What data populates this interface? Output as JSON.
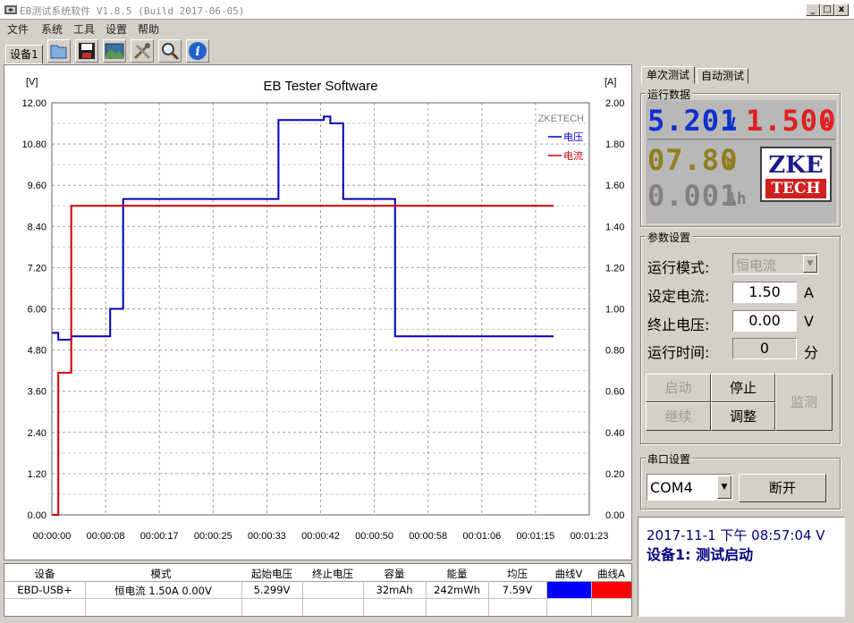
{
  "window": {
    "title": "EB测试系统软件 V1.8.5 (Build 2017-06-05)",
    "minimize": "_",
    "maximize": "□",
    "close": "x"
  },
  "menu": [
    "文件",
    "系统",
    "工具",
    "设置",
    "帮助"
  ],
  "device_tab": "设备1",
  "toolbar_icons": [
    "open-icon",
    "save-icon",
    "image-icon",
    "tools-icon",
    "search-icon",
    "info-icon"
  ],
  "chart_data": {
    "type": "line",
    "title": "EB Tester Software",
    "left_unit": "[V]",
    "right_unit": "[A]",
    "watermark": "ZKETECH",
    "left_ticks": [
      "12.00",
      "10.80",
      "9.60",
      "8.40",
      "7.20",
      "6.00",
      "4.80",
      "3.60",
      "2.40",
      "1.20",
      "0.00"
    ],
    "right_ticks": [
      "2.00",
      "1.80",
      "1.60",
      "1.40",
      "1.20",
      "1.00",
      "0.80",
      "0.60",
      "0.40",
      "0.20",
      "0.00"
    ],
    "x_ticks": [
      "00:00:00",
      "00:00:08",
      "00:00:17",
      "00:00:25",
      "00:00:33",
      "00:00:42",
      "00:00:50",
      "00:00:58",
      "00:01:06",
      "00:01:15",
      "00:01:23"
    ],
    "ylim_left": [
      0,
      12
    ],
    "ylim_right": [
      0,
      2
    ],
    "xlim": [
      0,
      83
    ],
    "legend_position": "top-right",
    "series": [
      {
        "name": "电压",
        "axis": "left",
        "color": "#0000c0",
        "points": [
          [
            0,
            5.3
          ],
          [
            1,
            5.3
          ],
          [
            1,
            5.1
          ],
          [
            3,
            5.1
          ],
          [
            3,
            5.2
          ],
          [
            9,
            5.2
          ],
          [
            9,
            6.0
          ],
          [
            11,
            6.0
          ],
          [
            11,
            9.2
          ],
          [
            35,
            9.2
          ],
          [
            35,
            11.5
          ],
          [
            42,
            11.5
          ],
          [
            42,
            11.6
          ],
          [
            43,
            11.6
          ],
          [
            43,
            11.4
          ],
          [
            45,
            11.4
          ],
          [
            45,
            9.2
          ],
          [
            53,
            9.2
          ],
          [
            53,
            5.2
          ],
          [
            77.5,
            5.2
          ]
        ]
      },
      {
        "name": "电流",
        "axis": "right",
        "color": "#d00000",
        "points": [
          [
            0,
            0.0
          ],
          [
            1,
            0.0
          ],
          [
            1,
            0.69
          ],
          [
            3,
            0.69
          ],
          [
            3,
            1.5
          ],
          [
            77.5,
            1.5
          ]
        ]
      }
    ]
  },
  "table": {
    "headers": [
      "设备",
      "模式",
      "起始电压",
      "终止电压",
      "容量",
      "能量",
      "均压",
      "曲线V",
      "曲线A"
    ],
    "row": {
      "device": "EBD-USB+",
      "mode": "恒电流  1.50A  0.00V",
      "start_v": "5.299V",
      "end_v": "",
      "capacity": "32mAh",
      "energy": "242mWh",
      "avg_v": "7.59V"
    },
    "curve_v_color": "#0000ff",
    "curve_a_color": "#ff0000"
  },
  "side_tabs": {
    "single": "单次测试",
    "auto": "自动测试"
  },
  "run_data": {
    "label": "运行数据",
    "voltage": "5.201",
    "voltage_unit": "V",
    "current": "1.500",
    "current_unit": "A",
    "power": "07.80",
    "power_unit": "W",
    "capacity": "0.001",
    "capacity_unit": "Ah",
    "logo_top": "ZKE",
    "logo_bottom": "TECH"
  },
  "params": {
    "label": "参数设置",
    "mode_label": "运行模式:",
    "mode_value": "恒电流",
    "set_current_label": "设定电流:",
    "set_current": "1.50",
    "set_current_unit": "A",
    "stop_voltage_label": "终止电压:",
    "stop_voltage": "0.00",
    "stop_voltage_unit": "V",
    "run_time_label": "运行时间:",
    "run_time": "0",
    "run_time_unit": "分",
    "buttons": {
      "start": "启动",
      "stop": "停止",
      "resume": "继续",
      "adjust": "调整",
      "monitor": "监测"
    }
  },
  "serial": {
    "label": "串口设置",
    "port": "COM4",
    "disconnect": "断开"
  },
  "log": {
    "line1": "2017-11-1 下午 08:57:04  V",
    "line2": "设备1: 测试启动"
  }
}
